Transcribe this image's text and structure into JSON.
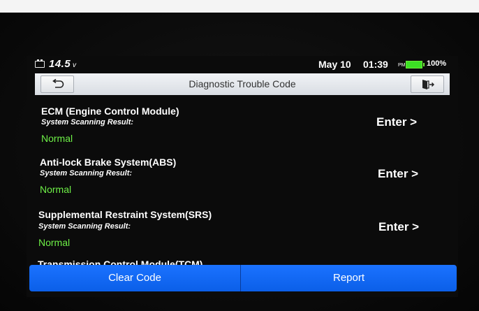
{
  "status_bar": {
    "voltage": "14.5",
    "voltage_unit": "v",
    "date": "May 10",
    "time": "01:39",
    "ampm": "PM",
    "battery_percent": "100%",
    "battery_color": "#3ce024",
    "battery_level": 1.0
  },
  "title_bar": {
    "title": "Diagnostic Trouble Code",
    "back_icon": "back-arrow-icon",
    "exit_icon": "exit-icon"
  },
  "systems": [
    {
      "name": "ECM (Engine Control Module)",
      "subtitle": "System Scanning Result:",
      "status": "Normal",
      "action": "Enter >"
    },
    {
      "name": "Anti-lock Brake System(ABS)",
      "subtitle": "System Scanning Result:",
      "status": "Normal",
      "action": "Enter >"
    },
    {
      "name": "Supplemental Restraint System(SRS)",
      "subtitle": "System Scanning Result:",
      "status": "Normal",
      "action": "Enter >"
    }
  ],
  "partial_item": "Transmission Control Module(TCM)",
  "buttons": {
    "clear_code": "Clear Code",
    "report": "Report"
  },
  "colors": {
    "accent_blue": "#1b72ff",
    "status_green": "#6ef047"
  }
}
